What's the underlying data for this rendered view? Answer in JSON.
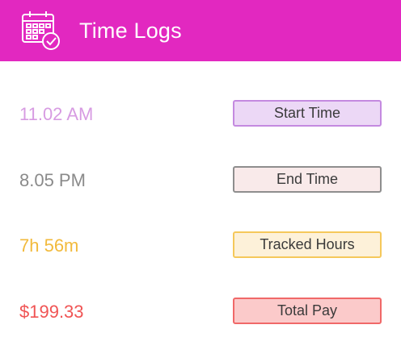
{
  "header": {
    "title": "Time Logs",
    "icon": "calendar-check-icon",
    "background": "#e228c0"
  },
  "rows": [
    {
      "value": "11.02 AM",
      "label": "Start Time",
      "value_color": "#d79be2",
      "label_bg": "#ecd8f6",
      "label_border": "#c48ae0"
    },
    {
      "value": "8.05 PM",
      "label": "End Time",
      "value_color": "#8a8a8a",
      "label_bg": "#f9eaea",
      "label_border": "#8e8e8e"
    },
    {
      "value": "7h 56m",
      "label": "Tracked Hours",
      "value_color": "#f2ba3c",
      "label_bg": "#fdf1d9",
      "label_border": "#f5c85a"
    },
    {
      "value": "$199.33",
      "label": "Total Pay",
      "value_color": "#f05454",
      "label_bg": "#fbcaca",
      "label_border": "#f06868"
    }
  ]
}
